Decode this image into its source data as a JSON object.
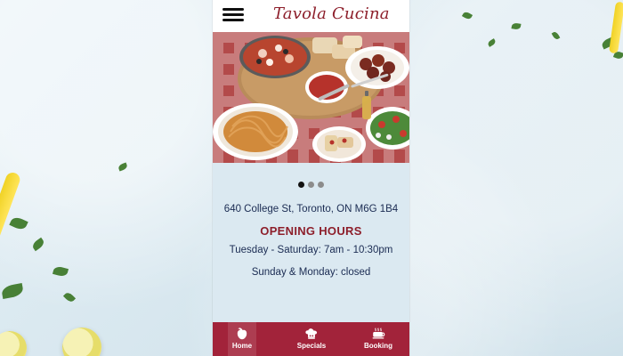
{
  "app": {
    "title": "Tavola Cucina"
  },
  "hero": {
    "image_alt": "Italian dishes"
  },
  "carousel": {
    "slides": 3,
    "active_index": 0
  },
  "info": {
    "address": "640 College St, Toronto, ON M6G 1B4",
    "hours_title": "OPENING HOURS",
    "hours_line_1": "Tuesday - Saturday: 7am - 10:30pm",
    "hours_line_2": "Sunday & Monday: closed"
  },
  "nav": {
    "items": [
      {
        "label": "Home",
        "icon": "apple-icon"
      },
      {
        "label": "Specials",
        "icon": "chef-hat-icon"
      },
      {
        "label": "Booking",
        "icon": "coffee-cup-icon"
      }
    ],
    "active_index": 0
  },
  "colors": {
    "brand": "#8d1f2b",
    "nav_bar": "#a2233a",
    "text": "#1a2b52"
  }
}
